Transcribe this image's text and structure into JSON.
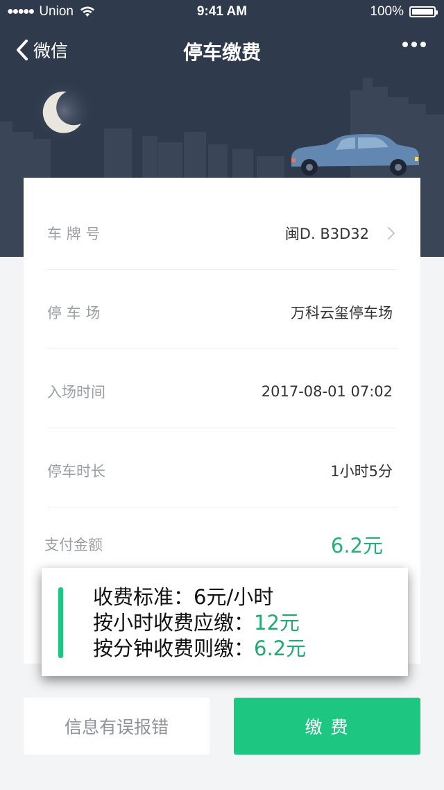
{
  "status_bar": {
    "signal": "●●●●●",
    "carrier": "Union",
    "time": "9:41 AM",
    "battery": "100%"
  },
  "nav": {
    "back_label": "微信",
    "title": "停车缴费",
    "back_icon": "chevron-left-icon",
    "more_icon": "more-dots-icon"
  },
  "details": {
    "plate_label": "车 牌 号",
    "plate_value": "闽D. B3D32",
    "lot_label": "停 车 场",
    "lot_value": "万科云玺停车场",
    "entry_label": "入场时间",
    "entry_value": "2017-08-01 07:02",
    "duration_label": "停车时长",
    "duration_value": "1小时5分",
    "amount_label": "支付金额",
    "amount_value": "6.2元"
  },
  "popup": {
    "line1": "收费标准：6元/小时",
    "line2_prefix": "按小时收费应缴：",
    "line2_value": "12元",
    "line3_prefix": "按分钟收费则缴：",
    "line3_value": "6.2元"
  },
  "actions": {
    "report_label": "信息有误报错",
    "pay_label": "缴 费"
  },
  "colors": {
    "hero_bg": "#2f3a4c",
    "accent_green": "#1ec781",
    "amount_green": "#22b07d"
  }
}
